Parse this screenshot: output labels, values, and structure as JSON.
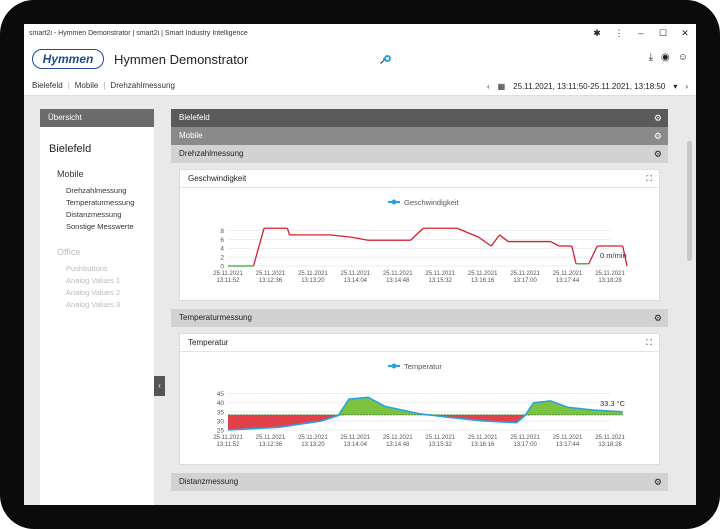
{
  "window": {
    "title": "smart2i - Hymmen Demonstrator | smart2i | Smart Industry Intelligence"
  },
  "header": {
    "logo": "Hymmen",
    "title": "Hymmen Demonstrator"
  },
  "breadcrumb": [
    "Bielefeld",
    "Mobile",
    "Drehzahlmessung"
  ],
  "date_range": "25.11.2021, 13:11:50-25.11.2021, 13:18:50",
  "sidebar": {
    "header": "Übersicht",
    "location": "Bielefeld",
    "groups": [
      {
        "label": "Mobile",
        "items": [
          "Drehzahlmessung",
          "Temperaturmessung",
          "Distanzmessung",
          "Sonstige Messwerte"
        ]
      },
      {
        "label": "Office",
        "items": [
          "Pushbuttons",
          "Analog Values 1",
          "Analog Values 2",
          "Analog Values 3"
        ]
      }
    ]
  },
  "main": {
    "bar_location": "Bielefeld",
    "bar_group": "Mobile",
    "sections": [
      {
        "title": "Drehzahlmessung",
        "panel_title": "Geschwindigkeit"
      },
      {
        "title": "Temperaturmessung",
        "panel_title": "Temperatur"
      },
      {
        "title": "Distanzmessung"
      }
    ]
  },
  "chart_data": [
    {
      "type": "line",
      "legend": "Geschwindigkeit",
      "series_color": "#29a3e0",
      "y_ticks": [
        0,
        2,
        4,
        6,
        8
      ],
      "ylim": [
        0,
        9
      ],
      "x_ticks": [
        "25.11.2021\n13:11:52",
        "25.11.2021\n13:12:36",
        "25.11.2021\n13:13:20",
        "25.11.2021\n13:14:04",
        "25.11.2021\n13:14:48",
        "25.11.2021\n13:15:32",
        "25.11.2021\n13:16:16",
        "25.11.2021\n13:17:00",
        "25.11.2021\n13:17:44",
        "25.11.2021\n13:18:28"
      ],
      "current_label": "0 m/min",
      "points": [
        [
          0,
          0
        ],
        [
          0.6,
          0
        ],
        [
          0.85,
          8.5
        ],
        [
          1.4,
          8.5
        ],
        [
          1.45,
          7
        ],
        [
          2.4,
          7
        ],
        [
          2.9,
          6.5
        ],
        [
          3.3,
          5.8
        ],
        [
          4.3,
          5.8
        ],
        [
          4.6,
          8.5
        ],
        [
          5.4,
          8.5
        ],
        [
          5.9,
          6.5
        ],
        [
          6.2,
          4.5
        ],
        [
          6.4,
          7
        ],
        [
          6.6,
          5.5
        ],
        [
          7.6,
          5.5
        ],
        [
          7.8,
          4.5
        ],
        [
          8.1,
          4.5
        ],
        [
          8.2,
          0.5
        ],
        [
          8.5,
          0.5
        ],
        [
          8.7,
          4.5
        ],
        [
          9.3,
          4.5
        ],
        [
          9.4,
          0
        ]
      ]
    },
    {
      "type": "area",
      "legend": "Temperatur",
      "series_color": "#29a3e0",
      "y_ticks": [
        25,
        30,
        35,
        40,
        45
      ],
      "ylim": [
        25,
        47
      ],
      "baseline": 33.3,
      "x_ticks": [
        "25.11.2021\n13:11:52",
        "25.11.2021\n13:12:36",
        "25.11.2021\n13:13:20",
        "25.11.2021\n13:14:04",
        "25.11.2021\n13:14:48",
        "25.11.2021\n13:15:32",
        "25.11.2021\n13:16:16",
        "25.11.2021\n13:17:00",
        "25.11.2021\n13:17:44",
        "25.11.2021\n13:18:28"
      ],
      "current_label": "33.3 °C",
      "points": [
        [
          0,
          25
        ],
        [
          1.2,
          26.5
        ],
        [
          2.2,
          30
        ],
        [
          2.6,
          33
        ],
        [
          2.85,
          42
        ],
        [
          3.3,
          43
        ],
        [
          3.7,
          38
        ],
        [
          4.5,
          34
        ],
        [
          5.2,
          32
        ],
        [
          6,
          30
        ],
        [
          6.8,
          29
        ],
        [
          7.0,
          33
        ],
        [
          7.2,
          40
        ],
        [
          7.6,
          41
        ],
        [
          8.0,
          37.5
        ],
        [
          8.6,
          36
        ],
        [
          9.3,
          35
        ]
      ]
    }
  ]
}
